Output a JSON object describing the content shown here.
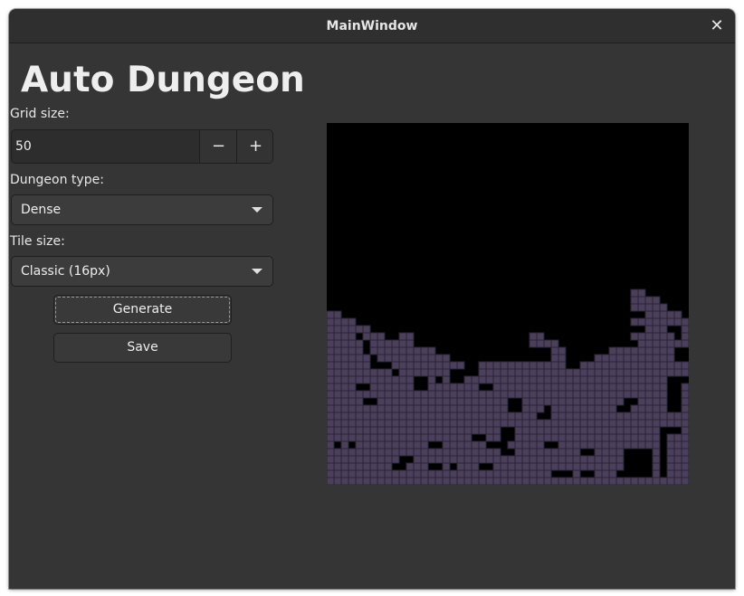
{
  "window": {
    "title": "MainWindow",
    "close_glyph": "✕"
  },
  "app": {
    "title": "Auto Dungeon"
  },
  "grid_size": {
    "label": "Grid size:",
    "value": "50",
    "decrement_glyph": "−",
    "increment_glyph": "+"
  },
  "dungeon_type": {
    "label": "Dungeon type:",
    "selected": "Dense"
  },
  "tile_size": {
    "label": "Tile size:",
    "selected": "Classic (16px)"
  },
  "buttons": {
    "generate": "Generate",
    "save": "Save"
  },
  "dungeon": {
    "grid": 50,
    "floor_color": "#4b3f5c",
    "wall_color": "#000000",
    "grid_line_color": "#2a2433",
    "column_floor_start_rows": [
      26,
      26,
      27,
      27,
      28,
      28,
      29,
      29,
      30,
      30,
      29,
      29,
      31,
      31,
      31,
      32,
      32,
      33,
      33,
      33,
      33,
      33,
      33,
      33,
      33,
      33,
      33,
      33,
      28,
      28,
      30,
      30,
      31,
      31,
      32,
      33,
      33,
      32,
      32,
      31,
      31,
      31,
      23,
      23,
      24,
      24,
      25,
      26,
      26,
      27
    ],
    "holes": [
      [
        4,
        29
      ],
      [
        5,
        30
      ],
      [
        5,
        31
      ],
      [
        6,
        32
      ],
      [
        6,
        33
      ],
      [
        7,
        33
      ],
      [
        8,
        33
      ],
      [
        9,
        34
      ],
      [
        4,
        36
      ],
      [
        5,
        36
      ],
      [
        12,
        35
      ],
      [
        13,
        35
      ],
      [
        12,
        36
      ],
      [
        13,
        36
      ],
      [
        15,
        35
      ],
      [
        17,
        34
      ],
      [
        18,
        34
      ],
      [
        17,
        35
      ],
      [
        18,
        35
      ],
      [
        19,
        33
      ],
      [
        20,
        33
      ],
      [
        19,
        34
      ],
      [
        20,
        34
      ],
      [
        21,
        36
      ],
      [
        22,
        36
      ],
      [
        25,
        38
      ],
      [
        26,
        38
      ],
      [
        25,
        39
      ],
      [
        26,
        39
      ],
      [
        30,
        39
      ],
      [
        29,
        40
      ],
      [
        30,
        40
      ],
      [
        1,
        44
      ],
      [
        3,
        44
      ],
      [
        14,
        44
      ],
      [
        15,
        44
      ],
      [
        20,
        43
      ],
      [
        21,
        43
      ],
      [
        22,
        44
      ],
      [
        23,
        44
      ],
      [
        24,
        44
      ],
      [
        24,
        42
      ],
      [
        25,
        42
      ],
      [
        24,
        43
      ],
      [
        25,
        43
      ],
      [
        24,
        45
      ],
      [
        25,
        45
      ],
      [
        10,
        46
      ],
      [
        11,
        46
      ],
      [
        9,
        47
      ],
      [
        10,
        47
      ],
      [
        14,
        47
      ],
      [
        15,
        47
      ],
      [
        17,
        47
      ],
      [
        21,
        47
      ],
      [
        22,
        47
      ],
      [
        30,
        44
      ],
      [
        31,
        44
      ],
      [
        35,
        45
      ],
      [
        36,
        45
      ],
      [
        31,
        48
      ],
      [
        32,
        48
      ],
      [
        33,
        48
      ],
      [
        35,
        48
      ],
      [
        36,
        48
      ],
      [
        41,
        45
      ],
      [
        42,
        45
      ],
      [
        43,
        45
      ],
      [
        44,
        45
      ],
      [
        41,
        46
      ],
      [
        42,
        46
      ],
      [
        43,
        46
      ],
      [
        44,
        46
      ],
      [
        41,
        47
      ],
      [
        42,
        47
      ],
      [
        43,
        47
      ],
      [
        44,
        47
      ],
      [
        40,
        48
      ],
      [
        41,
        48
      ],
      [
        42,
        48
      ],
      [
        43,
        48
      ],
      [
        44,
        48
      ],
      [
        46,
        42
      ],
      [
        47,
        42
      ],
      [
        48,
        42
      ],
      [
        46,
        43
      ],
      [
        46,
        44
      ],
      [
        46,
        45
      ],
      [
        46,
        46
      ],
      [
        46,
        47
      ],
      [
        46,
        48
      ],
      [
        47,
        38
      ],
      [
        48,
        38
      ],
      [
        47,
        39
      ],
      [
        48,
        39
      ],
      [
        48,
        31
      ],
      [
        49,
        31
      ],
      [
        48,
        32
      ],
      [
        49,
        32
      ],
      [
        47,
        35
      ],
      [
        48,
        35
      ],
      [
        49,
        35
      ],
      [
        47,
        36
      ],
      [
        48,
        36
      ],
      [
        47,
        37
      ],
      [
        48,
        37
      ],
      [
        47,
        24
      ],
      [
        47,
        28
      ],
      [
        48,
        28
      ],
      [
        48,
        29
      ],
      [
        42,
        26
      ],
      [
        43,
        26
      ],
      [
        42,
        28
      ],
      [
        43,
        28
      ],
      [
        41,
        30
      ],
      [
        42,
        30
      ],
      [
        28,
        27
      ],
      [
        29,
        27
      ],
      [
        30,
        27
      ],
      [
        28,
        28
      ],
      [
        29,
        28
      ],
      [
        30,
        28
      ],
      [
        37,
        25
      ],
      [
        38,
        25
      ],
      [
        39,
        25
      ],
      [
        36,
        26
      ],
      [
        37,
        26
      ],
      [
        38,
        26
      ],
      [
        39,
        26
      ],
      [
        33,
        28
      ],
      [
        34,
        28
      ],
      [
        28,
        31
      ],
      [
        29,
        31
      ],
      [
        30,
        31
      ],
      [
        28,
        32
      ],
      [
        29,
        32
      ],
      [
        30,
        32
      ],
      [
        33,
        31
      ],
      [
        34,
        31
      ],
      [
        35,
        31
      ],
      [
        33,
        32
      ],
      [
        34,
        32
      ],
      [
        35,
        32
      ],
      [
        33,
        33
      ],
      [
        34,
        33
      ],
      [
        41,
        38
      ],
      [
        42,
        38
      ],
      [
        41,
        39
      ],
      [
        40,
        39
      ],
      [
        5,
        38
      ],
      [
        6,
        38
      ]
    ]
  }
}
